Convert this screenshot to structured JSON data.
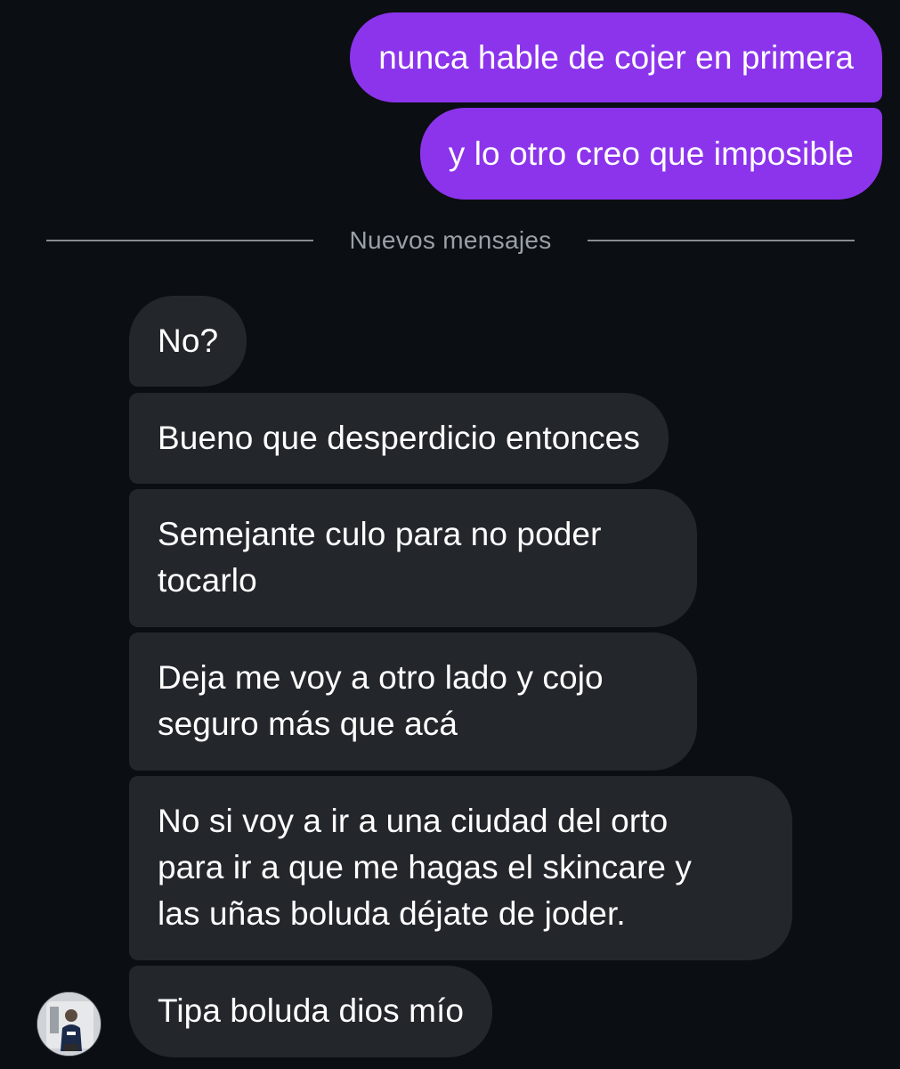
{
  "thread": {
    "outgoing": [
      {
        "text": "nunca hable de cojer en primera"
      },
      {
        "text": "y lo otro creo que imposible"
      }
    ],
    "divider_label": "Nuevos mensajes",
    "incoming": [
      {
        "text": "No?"
      },
      {
        "text": "Bueno que desperdicio entonces"
      },
      {
        "text": "Semejante culo para no poder\ntocarlo"
      },
      {
        "text": "Deja me voy a otro lado y cojo\nseguro más que acá"
      },
      {
        "text": "No si voy a ir a una ciudad del orto\npara ir a que me hagas el skincare y\nlas uñas boluda déjate de joder."
      },
      {
        "text": "Tipa boluda dios mío"
      }
    ]
  },
  "colors": {
    "background": "#0b0e12",
    "outgoing_bubble": "#8c34ec",
    "incoming_bubble": "#23272c",
    "divider": "#878c93"
  },
  "icons": {
    "avatar": "sender-avatar-photo"
  }
}
